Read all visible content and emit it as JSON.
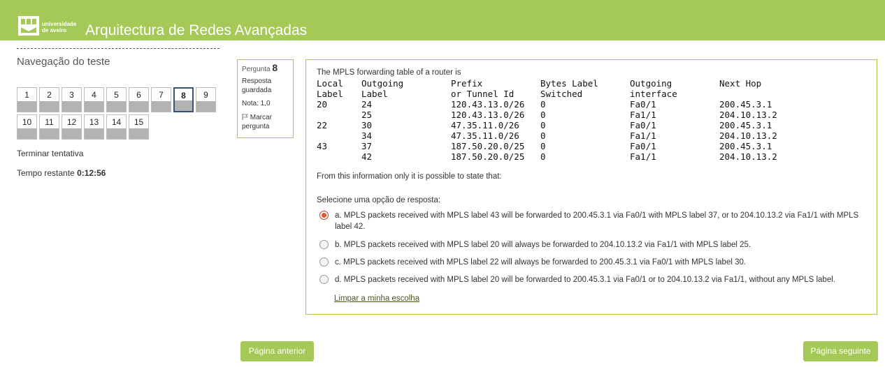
{
  "header": {
    "logo_text_line1": "universidade",
    "logo_text_line2": "de aveiro",
    "site_title": "Arquitectura de Redes Avançadas",
    "brand_color": "#a5c957"
  },
  "nav": {
    "title": "Navegação do teste",
    "questions": [
      "1",
      "2",
      "3",
      "4",
      "5",
      "6",
      "7",
      "8",
      "9",
      "10",
      "11",
      "12",
      "13",
      "14",
      "15"
    ],
    "current_question": "8",
    "finish_label": "Terminar tentativa",
    "timer_label": "Tempo restante",
    "timer_value": "0:12:56"
  },
  "info": {
    "question_label": "Pergunta",
    "question_number": "8",
    "state": "Resposta guardada",
    "grade": "Nota: 1,0",
    "flag_label": "Marcar pergunta",
    "flag_icon": "flag-icon"
  },
  "question": {
    "intro": "The MPLS forwarding table of a router is",
    "table_header_1": [
      "Local",
      "Outgoing",
      "Prefix",
      "Bytes Label",
      "Outgoing",
      "Next Hop"
    ],
    "table_header_2": [
      "Label",
      "Label",
      "or Tunnel Id",
      "Switched",
      "interface",
      ""
    ],
    "table_rows": [
      [
        "20",
        "24",
        "120.43.13.0/26",
        "0",
        "Fa0/1",
        "200.45.3.1"
      ],
      [
        "",
        "25",
        "120.43.13.0/26",
        "0",
        "Fa1/1",
        "204.10.13.2"
      ],
      [
        "22",
        "30",
        "47.35.11.0/26",
        "0",
        "Fa0/1",
        "200.45.3.1"
      ],
      [
        "",
        "34",
        "47.35.11.0/26",
        "0",
        "Fa1/1",
        "204.10.13.2"
      ],
      [
        "43",
        "37",
        "187.50.20.0/25",
        "0",
        "Fa0/1",
        "200.45.3.1"
      ],
      [
        "",
        "42",
        "187.50.20.0/25",
        "0",
        "Fa1/1",
        "204.10.13.2"
      ]
    ],
    "text": "From this information only it is possible to state that:",
    "prompt": "Selecione uma opção de resposta:",
    "options": [
      "a. MPLS packets received with MPLS label 43 will be forwarded to 200.45.3.1 via Fa0/1 with MPLS label 37, or to 204.10.13.2 via Fa1/1 with MPLS label 42.",
      "b. MPLS packets received with MPLS label 20 will always be forwarded to 204.10.13.2 via Fa1/1 with MPLS label 25.",
      "c. MPLS packets received with MPLS label 22 will always be forwarded to 200.45.3.1 via Fa0/1 with MPLS label 30.",
      "d. MPLS packets received with MPLS label 20 will be forwarded to 200.45.3.1 via Fa0/1 or to 204.10.13.2 via Fa1/1, without any MPLS label."
    ],
    "selected_option": "a",
    "clear_label": "Limpar a minha escolha"
  },
  "buttons": {
    "prev_label": "Página anterior",
    "next_label": "Página seguinte"
  }
}
